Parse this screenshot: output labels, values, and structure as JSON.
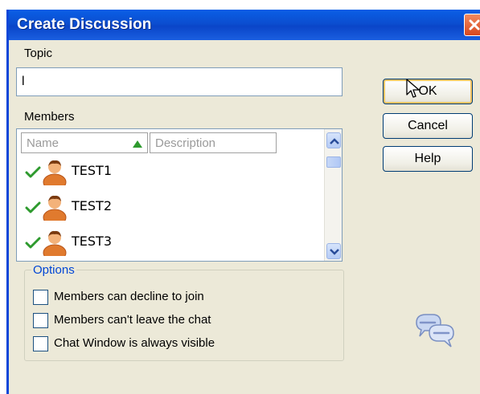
{
  "window": {
    "title": "Create Discussion"
  },
  "topic": {
    "label": "Topic",
    "value": "l"
  },
  "members": {
    "label": "Members",
    "columns": [
      "Name",
      "Description"
    ],
    "rows": [
      {
        "name": "TEST1",
        "checked": true
      },
      {
        "name": "TEST2",
        "checked": true
      },
      {
        "name": "TEST3",
        "checked": true
      }
    ]
  },
  "options": {
    "legend": "Options",
    "items": [
      {
        "label": "Members can decline to join",
        "checked": false
      },
      {
        "label": "Members can't leave the chat",
        "checked": false
      },
      {
        "label": "Chat Window is always visible",
        "checked": false
      }
    ]
  },
  "buttons": {
    "ok": "OK",
    "cancel": "Cancel",
    "help": "Help"
  },
  "colors": {
    "titlebar": "#0A4ED0",
    "dialog_bg": "#ECE9D8",
    "legend": "#0046D5",
    "check": "#2E9A2E",
    "close": "#D8471E"
  },
  "icons": [
    "close-icon",
    "sort-ascending-icon",
    "checkmark-icon",
    "user-avatar-icon",
    "scroll-up-icon",
    "scroll-down-icon",
    "chat-bubbles-icon",
    "mouse-cursor-icon"
  ]
}
